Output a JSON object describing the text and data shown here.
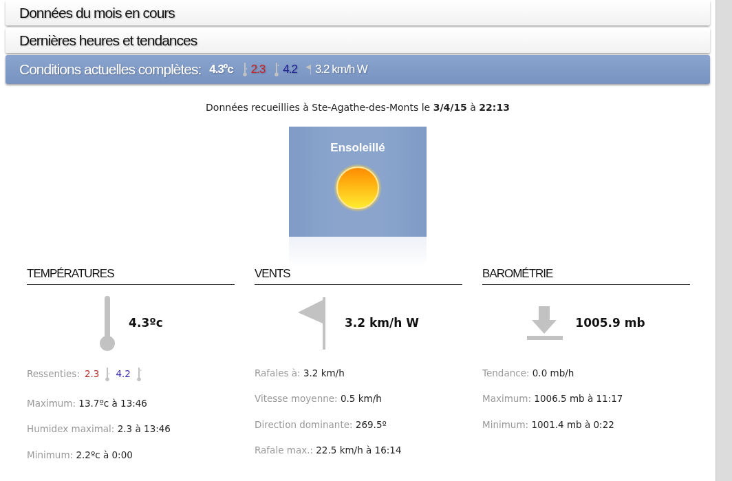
{
  "panels": [
    {
      "title": "Données du mois en cours",
      "expanded": false
    },
    {
      "title": "Dernières heures et tendances",
      "expanded": false
    },
    {
      "title": "Conditions actuelles complètes:",
      "expanded": true,
      "summary": {
        "temperature": "4.3ºc",
        "feels": [
          {
            "value": "2.3",
            "color": "#cc1f1f"
          },
          {
            "value": "4.2",
            "color": "#22229a"
          }
        ],
        "wind": "3.2 km/h W"
      }
    }
  ],
  "record_line": "Données recueillies à Ste-Agathe-des-Monts le **3/4/15** à **22:13**",
  "condition": {
    "label": "Ensoleillé"
  },
  "sections": [
    {
      "kind": "temperature",
      "title": "TEMPÉRATURES",
      "main": "4.3ºc",
      "rows": [
        {
          "kind": "feels",
          "label": "Ressenties:",
          "values": [
            {
              "value": "2.3",
              "color": "#b5302a"
            },
            {
              "value": "4.2",
              "color": "#3b2fb0"
            }
          ]
        },
        {
          "kind": "text",
          "label": "Maximum:",
          "value": "13.7ºc à 13:46"
        },
        {
          "kind": "text",
          "label": "Humidex maximal:",
          "value": "2.3 à 13:46"
        },
        {
          "kind": "text",
          "label": "Minimum:",
          "value": "2.2ºc à 0:00"
        }
      ]
    },
    {
      "kind": "wind",
      "title": "VENTS",
      "main": "3.2 km/h W",
      "rows": [
        {
          "kind": "text",
          "label": "Rafales à:",
          "value": "3.2 km/h"
        },
        {
          "kind": "text",
          "label": "Vitesse moyenne:",
          "value": "0.5 km/h"
        },
        {
          "kind": "text",
          "label": "Direction dominante:",
          "value": "269.5º"
        },
        {
          "kind": "text",
          "label": "Rafale max.:",
          "value": "22.5 km/h à 16:14"
        }
      ]
    },
    {
      "kind": "pressure",
      "title": "BAROMÉTRIE",
      "main": "1005.9 mb",
      "rows": [
        {
          "kind": "text",
          "label": "Tendance:",
          "value": "0.0 mb/h"
        },
        {
          "kind": "text",
          "label": "Maximum:",
          "value": "1006.5 mb à 11:17"
        },
        {
          "kind": "text",
          "label": "Minimum:",
          "value": "1001.4 mb à 0:22"
        }
      ]
    }
  ]
}
